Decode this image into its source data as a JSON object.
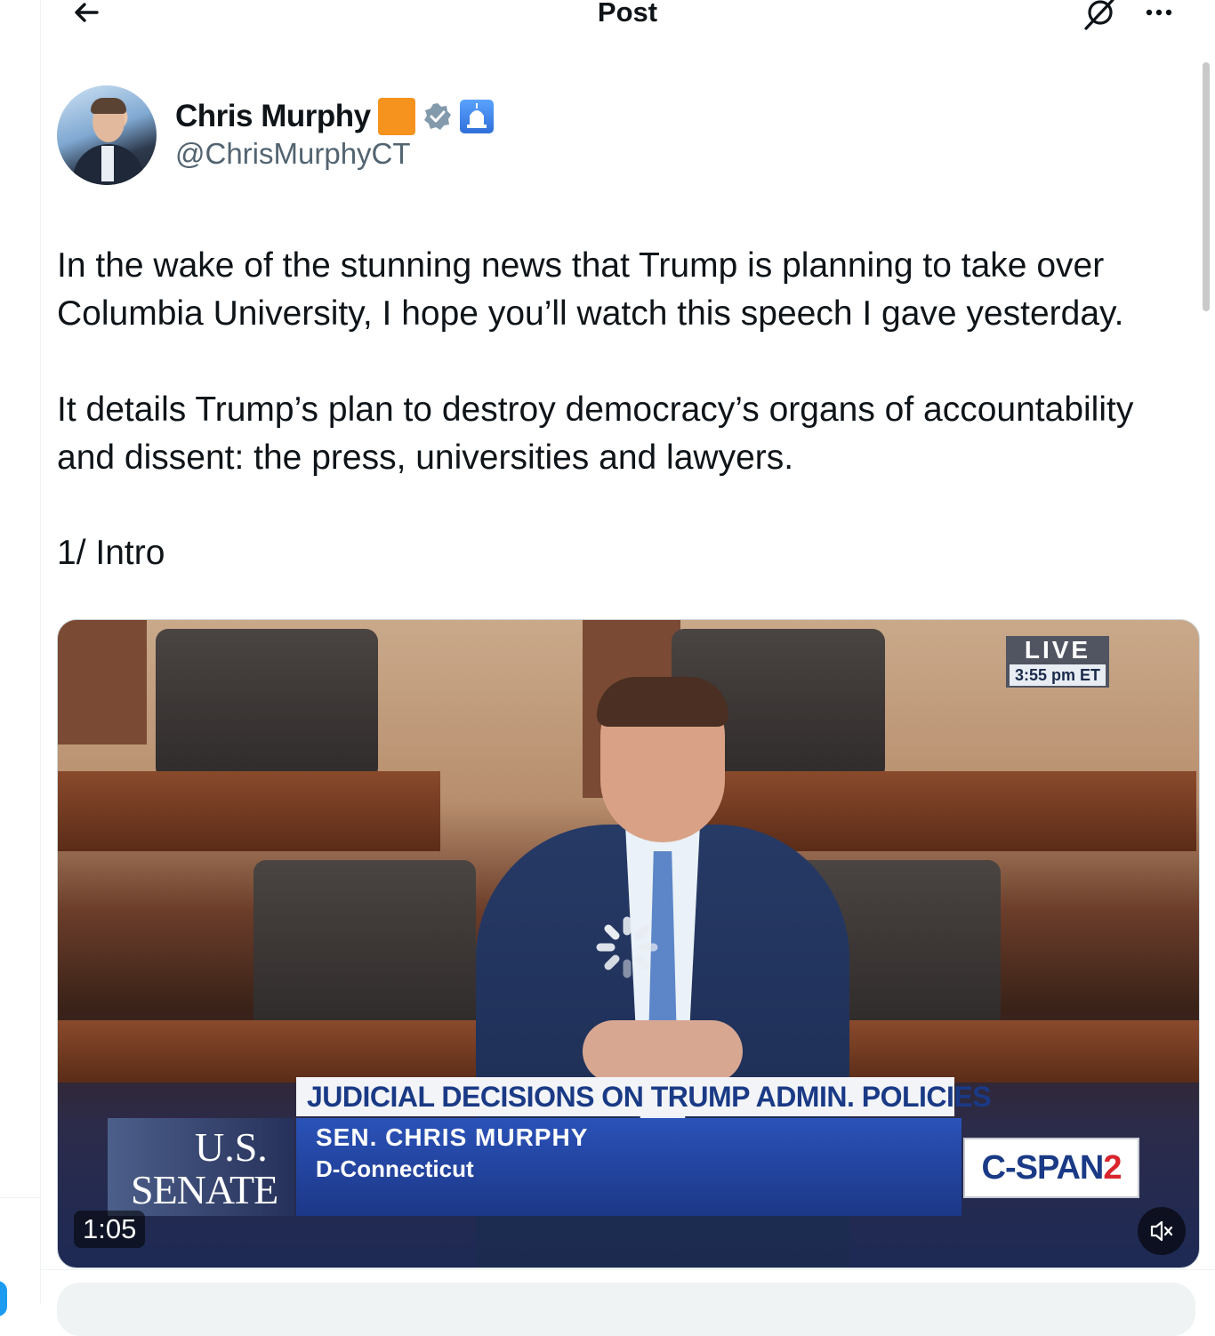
{
  "header": {
    "title": "Post"
  },
  "post": {
    "author": {
      "name": "Chris Murphy",
      "handle": "@ChrisMurphyCT"
    },
    "paragraphs": [
      "In the wake of the stunning news that Trump is planning to take over Columbia University, I hope you’ll watch this speech I gave yesterday.",
      "It details Trump’s plan to destroy democracy’s organs of accountability and dissent: the press, universities and lawyers.",
      "1/ Intro"
    ],
    "video": {
      "live_label": "LIVE",
      "live_time": "3:55 pm ET",
      "headline": "JUDICIAL DECISIONS ON TRUMP ADMIN. POLICIES",
      "speaker": "SEN. CHRIS MURPHY",
      "party_state": "D-Connecticut",
      "logo_line1": "U.S.",
      "logo_line2": "SENATE",
      "network_a": "C-SPAN",
      "network_b": "2",
      "duration": "1:05"
    }
  },
  "colors": {
    "verified": "#1d9bf0",
    "accent": "#1d9bf0",
    "badge_orange": "#f6931e"
  },
  "icons": [
    "back-arrow-icon",
    "grok-icon",
    "more-icon",
    "verified-icon",
    "capitol-icon",
    "loading-spinner-icon",
    "mute-icon"
  ]
}
